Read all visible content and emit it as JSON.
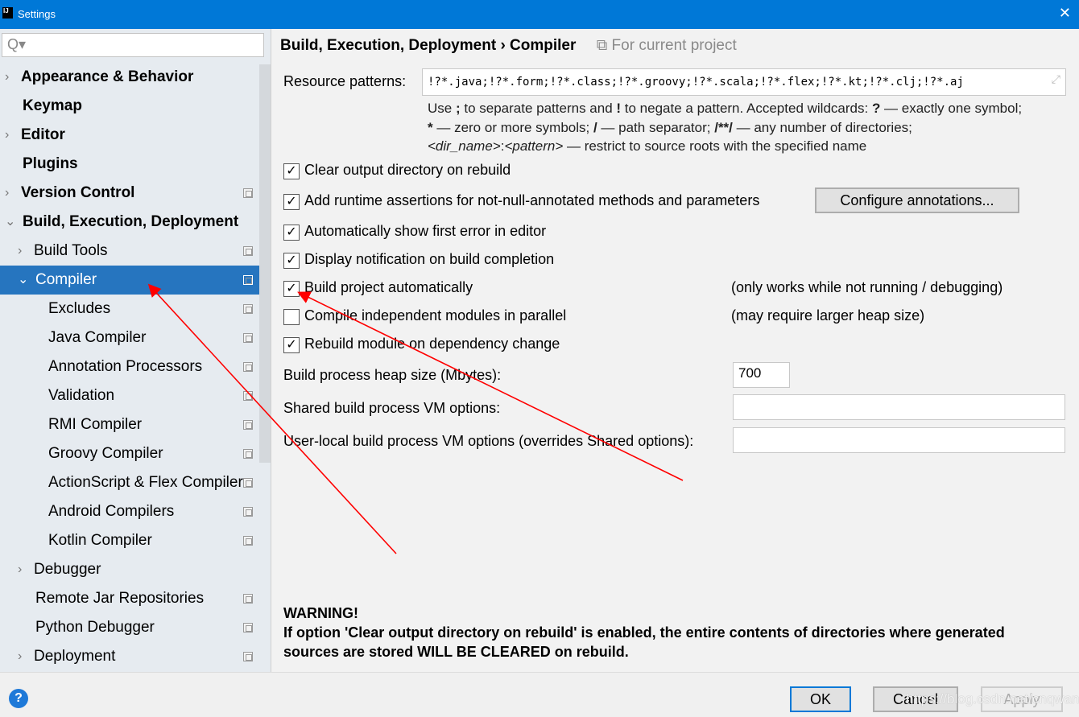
{
  "window": {
    "title": "Settings",
    "logo": "IJ"
  },
  "sidebar": {
    "search_placeholder": "Q▾",
    "items": [
      {
        "label": "Appearance & Behavior",
        "arrow": "›"
      },
      {
        "label": "Keymap",
        "arrow": ""
      },
      {
        "label": "Editor",
        "arrow": "›"
      },
      {
        "label": "Plugins",
        "arrow": ""
      },
      {
        "label": "Version Control",
        "arrow": "›"
      },
      {
        "label": "Build, Execution, Deployment",
        "arrow": "⌄"
      },
      {
        "label": "Build Tools",
        "arrow": "›"
      },
      {
        "label": "Compiler",
        "arrow": "⌄"
      },
      {
        "label": "Excludes",
        "arrow": ""
      },
      {
        "label": "Java Compiler",
        "arrow": ""
      },
      {
        "label": "Annotation Processors",
        "arrow": ""
      },
      {
        "label": "Validation",
        "arrow": ""
      },
      {
        "label": "RMI Compiler",
        "arrow": ""
      },
      {
        "label": "Groovy Compiler",
        "arrow": ""
      },
      {
        "label": "ActionScript & Flex Compiler",
        "arrow": ""
      },
      {
        "label": "Android Compilers",
        "arrow": ""
      },
      {
        "label": "Kotlin Compiler",
        "arrow": ""
      },
      {
        "label": "Debugger",
        "arrow": "›"
      },
      {
        "label": "Remote Jar Repositories",
        "arrow": ""
      },
      {
        "label": "Python Debugger",
        "arrow": ""
      },
      {
        "label": "Deployment",
        "arrow": "›"
      }
    ]
  },
  "main": {
    "breadcrumb": {
      "parent": "Build, Execution, Deployment",
      "sep": "›",
      "current": "Compiler",
      "scope": "For current project"
    },
    "resource_patterns": {
      "label": "Resource patterns:",
      "value": "!?*.java;!?*.form;!?*.class;!?*.groovy;!?*.scala;!?*.flex;!?*.kt;!?*.clj;!?*.aj"
    },
    "hint": {
      "l1a": "Use ",
      "sc": ";",
      "l1b": " to separate patterns and ",
      "bang": "!",
      "l1c": " to negate a pattern. Accepted wildcards: ",
      "q": "?",
      "l1d": " — exactly one symbol; ",
      "star": "*",
      "l2a": " — zero or more symbols; ",
      "slash": "/",
      "l2b": " — path separator; ",
      "dstar": "/**/",
      "l2c": " — any number of directories;",
      "dir": "<dir_name>",
      "colon": ":",
      "pat": "<pattern>",
      "l3": " — restrict to source roots with the specified name"
    },
    "options": [
      {
        "label": "Clear output directory on rebuild",
        "checked": true,
        "note": ""
      },
      {
        "label": "Add runtime assertions for not-null-annotated methods and parameters",
        "checked": true,
        "note": ""
      },
      {
        "label": "Automatically show first error in editor",
        "checked": true,
        "note": ""
      },
      {
        "label": "Display notification on build completion",
        "checked": true,
        "note": ""
      },
      {
        "label": "Build project automatically",
        "checked": true,
        "note": "(only works while not running / debugging)"
      },
      {
        "label": "Compile independent modules in parallel",
        "checked": false,
        "note": "(may require larger heap size)"
      },
      {
        "label": "Rebuild module on dependency change",
        "checked": true,
        "note": ""
      }
    ],
    "configure_annotations": "Configure annotations...",
    "heap": {
      "label": "Build process heap size (Mbytes):",
      "value": "700"
    },
    "shared_vm": {
      "label": "Shared build process VM options:",
      "value": ""
    },
    "local_vm": {
      "label": "User-local build process VM options (overrides Shared options):",
      "value": ""
    },
    "warning": {
      "title": "WARNING!",
      "text1": "If option 'Clear output directory on rebuild' is enabled, the entire contents of directories where generated",
      "text2": "sources are stored WILL BE CLEARED on rebuild."
    }
  },
  "footer": {
    "help": "?",
    "ok": "OK",
    "cancel": "Cancel",
    "apply": "Apply",
    "watermark": "https://blog.csdn.net/cnqwan"
  },
  "annotation_color": "#ff0000",
  "accent": "#2675bf"
}
